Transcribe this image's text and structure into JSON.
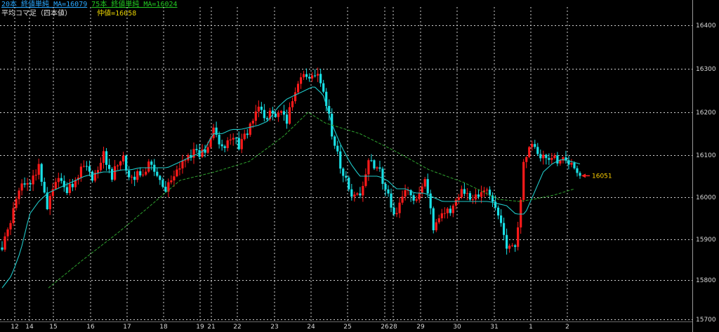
{
  "legend": {
    "ma20_label": "20本 終値単純 MA=16079",
    "ma75_label": "75本 終値単純 MA=16024",
    "candle_label": "平均コマ足（四本値）",
    "mid_label": "仲値=16058"
  },
  "colors": {
    "up": "#ff1a1a",
    "down": "#19e0e6",
    "ma20": "#1fc8c8",
    "ma75": "#2ea02e",
    "grid": "#d0d0d0",
    "marker": "#ff2020",
    "marker_text": "#ffd000",
    "legend_ma20": "#2aa8ff",
    "legend_ma75": "#22c822",
    "legend_candle": "#e0e0e0",
    "legend_mid": "#e8d200"
  },
  "chart_data": {
    "type": "candlestick",
    "ylim": [
      15700,
      16450
    ],
    "y_ticks": [
      15700,
      15800,
      15900,
      16000,
      16100,
      16200,
      16300,
      16400
    ],
    "x_ticks": [
      "12",
      "14",
      "15",
      "16",
      "17",
      "18",
      "19",
      "21",
      "22",
      "23",
      "24",
      "25",
      "26",
      "28",
      "29",
      "30",
      "31",
      "1",
      "2"
    ],
    "price_path": [
      15880,
      15945,
      16035,
      16020,
      16070,
      15975,
      16045,
      16015,
      16030,
      16085,
      16045,
      16105,
      16050,
      16100,
      16045,
      16050,
      16085,
      16050,
      16020,
      16065,
      16095,
      16110,
      16100,
      16160,
      16125,
      16140,
      16120,
      16165,
      16210,
      16190,
      16200,
      16180,
      16255,
      16280,
      16300,
      16260,
      16150,
      16070,
      16010,
      16005,
      16080,
      16080,
      16000,
      15960,
      16020,
      15975,
      16050,
      15930,
      15975,
      15960,
      16010,
      16005,
      15990,
      16030,
      15950,
      15890,
      15880,
      16105,
      16120,
      16090,
      16100,
      16085,
      16070,
      16058
    ],
    "ma20_path": [
      15780,
      15810,
      15870,
      15960,
      15990,
      16010,
      16020,
      16030,
      16040,
      16050,
      16055,
      16060,
      16060,
      16065,
      16065,
      16070,
      16070,
      16070,
      16070,
      16080,
      16090,
      16100,
      16110,
      16150,
      16150,
      16160,
      16160,
      16165,
      16170,
      16180,
      16210,
      16230,
      16240,
      16250,
      16260,
      16240,
      16170,
      16120,
      16080,
      16050,
      16050,
      16050,
      16040,
      16020,
      16020,
      16010,
      16010,
      16000,
      15990,
      15990,
      15990,
      15990,
      15990,
      15990,
      15985,
      15980,
      15960,
      15960,
      16010,
      16060,
      16080,
      16090,
      16085,
      16079
    ],
    "ma75_path": [
      [
        0.07,
        15780
      ],
      [
        0.12,
        15850
      ],
      [
        0.17,
        15915
      ],
      [
        0.21,
        15970
      ],
      [
        0.26,
        16040
      ],
      [
        0.31,
        16060
      ],
      [
        0.36,
        16085
      ],
      [
        0.41,
        16145
      ],
      [
        0.445,
        16200
      ],
      [
        0.47,
        16175
      ],
      [
        0.52,
        16150
      ],
      [
        0.57,
        16110
      ],
      [
        0.62,
        16065
      ],
      [
        0.67,
        16035
      ],
      [
        0.72,
        15995
      ],
      [
        0.75,
        15990
      ],
      [
        0.77,
        15995
      ],
      [
        0.8,
        16005
      ],
      [
        0.83,
        16020
      ]
    ],
    "last_price": "16051",
    "last_price_value": 16051,
    "grid": true
  }
}
